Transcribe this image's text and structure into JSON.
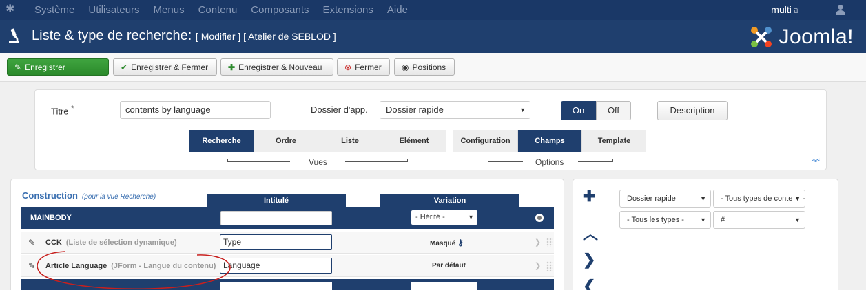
{
  "topnav": {
    "menu": [
      "Système",
      "Utilisateurs",
      "Menus",
      "Contenu",
      "Composants",
      "Extensions",
      "Aide"
    ],
    "user": "multi"
  },
  "header": {
    "title": "Liste & type de recherche:",
    "subtitle": "[ Modifier ] [ Atelier de SEBLOD ]",
    "brand": "Joomla!"
  },
  "toolbar": {
    "save": "Enregistrer",
    "save_close": "Enregistrer & Fermer",
    "save_new": "Enregistrer & Nouveau",
    "close": "Fermer",
    "positions": "Positions"
  },
  "form": {
    "title_label": "Titre",
    "title_required": "*",
    "title_value": "contents by language",
    "folder_label": "Dossier d'app.",
    "folder_value": "Dossier rapide",
    "toggle_on": "On",
    "toggle_off": "Off",
    "description": "Description"
  },
  "tabs": {
    "views": [
      "Recherche",
      "Ordre",
      "Liste",
      "Elément"
    ],
    "options": [
      "Configuration",
      "Champs",
      "Template"
    ],
    "views_label": "Vues",
    "options_label": "Options"
  },
  "construction": {
    "title": "Construction",
    "note": "(pour la vue Recherche)",
    "col_label": "Intitulé",
    "col_variation": "Variation",
    "mainbody": "MAINBODY",
    "mainbody_variation": "- Hérité -",
    "rows": [
      {
        "name": "CCK",
        "sub": "(Liste de sélection dynamique)",
        "label": "Type",
        "variation": "Masqué"
      },
      {
        "name": "Article Language",
        "sub": "(JForm - Langue du contenu)",
        "label": "Language",
        "variation": "Par défaut"
      }
    ]
  },
  "filters": {
    "folder": "Dossier rapide",
    "content_types": "- Tous types de contenu -",
    "types": "- Tous les types -",
    "hash": "#"
  },
  "colors": {
    "navy": "#1f3f6e",
    "green": "#2e8b2e",
    "annotation": "#c8201e"
  }
}
